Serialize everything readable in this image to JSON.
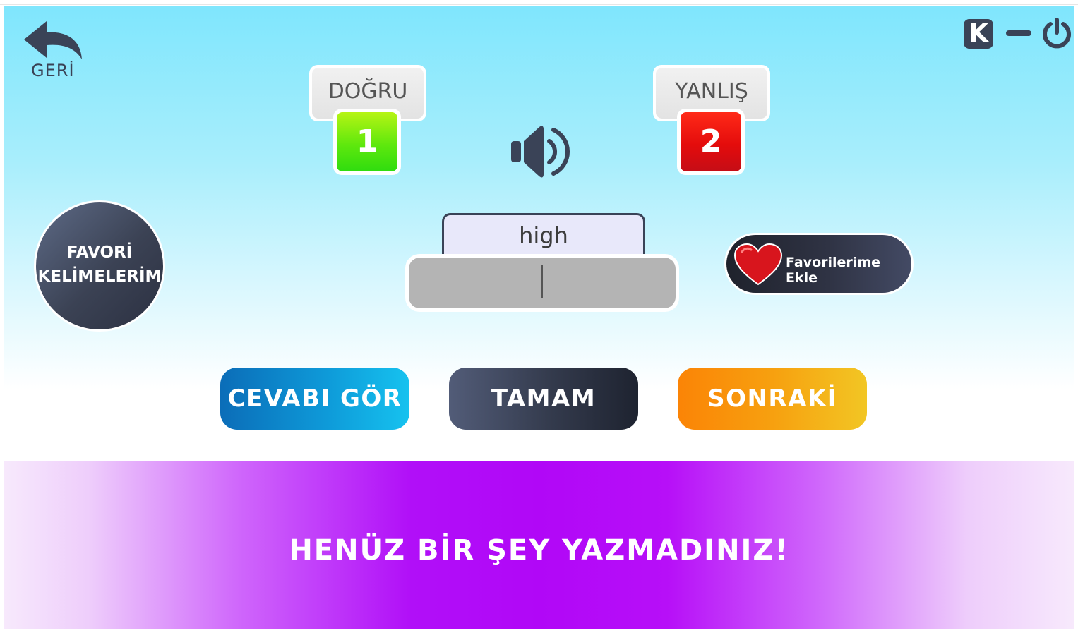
{
  "nav": {
    "back_label": "GERİ"
  },
  "window": {
    "k_label": "K"
  },
  "score": {
    "correct_label": "DOĞRU",
    "correct_value": "1",
    "wrong_label": "YANLIŞ",
    "wrong_value": "2"
  },
  "favorites": {
    "circle_line1": "FAVORİ",
    "circle_line2": "KELİMELERİM",
    "add_label": "Favorilerime Ekle"
  },
  "question": {
    "word": "high",
    "answer_value": ""
  },
  "actions": {
    "show_answer": "CEVABI GÖR",
    "ok": "TAMAM",
    "next": "SONRAKİ"
  },
  "message": {
    "text": "HENÜZ BİR ŞEY YAZMADINIZ!"
  },
  "icons": {
    "back": "back-arrow-icon",
    "speaker": "speaker-icon",
    "heart": "heart-icon",
    "minimize": "minimize-icon",
    "power": "power-icon"
  },
  "colors": {
    "correct": "#4ee20e",
    "wrong": "#e00c0c",
    "dark": "#3a4357",
    "message_bg": "#b107f7"
  }
}
